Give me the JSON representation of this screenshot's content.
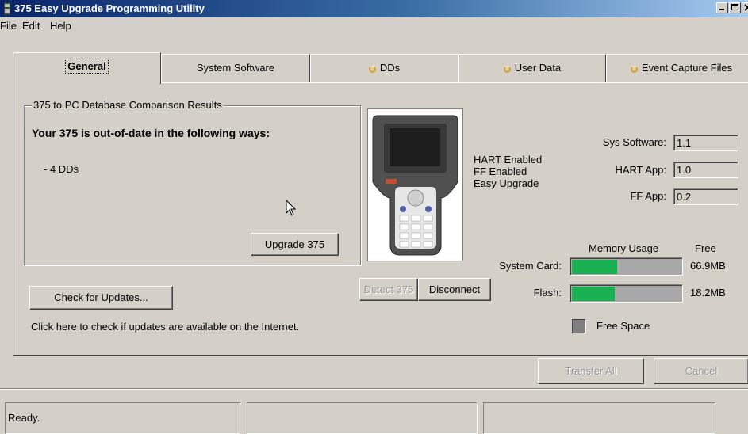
{
  "window": {
    "title": "375 Easy Upgrade Programming Utility"
  },
  "menu": [
    "File",
    "Edit",
    "Help"
  ],
  "tabs": [
    {
      "label": "General",
      "active": true,
      "icon": ""
    },
    {
      "label": "System Software",
      "active": false,
      "icon": ""
    },
    {
      "label": "DDs",
      "active": false,
      "icon": "status-circle-icon"
    },
    {
      "label": "User Data",
      "active": false,
      "icon": "status-circle-icon"
    },
    {
      "label": "Event Capture Files",
      "active": false,
      "icon": "status-circle-icon"
    }
  ],
  "comparison": {
    "group_title": "375 to PC Database Comparison Results",
    "heading": "Your 375 is out-of-date in the following ways:",
    "items": [
      "- 4 DDs"
    ],
    "upgrade_button": "Upgrade 375"
  },
  "updates": {
    "check_button": "Check for Updates...",
    "hint": "Click here to check if updates are available on the Internet."
  },
  "device": {
    "capabilities": [
      "HART Enabled",
      "FF Enabled",
      "Easy Upgrade"
    ],
    "detect_button": "Detect 375",
    "disconnect_button": "Disconnect",
    "versions": [
      {
        "label": "Sys Software:",
        "value": "1.1"
      },
      {
        "label": "HART App:",
        "value": "1.0"
      },
      {
        "label": "FF App:",
        "value": "0.2"
      }
    ]
  },
  "memory": {
    "header": "Memory Usage",
    "free_header": "Free",
    "rows": [
      {
        "label": "System Card:",
        "used_fraction": 0.41,
        "free": "66.9MB"
      },
      {
        "label": "Flash:",
        "used_fraction": 0.39,
        "free": "18.2MB"
      }
    ],
    "legend": "Free Space",
    "used_color": "#18b050",
    "free_color": "#a8a8a8"
  },
  "actions": {
    "transfer_all": "Transfer All",
    "cancel": "Cancel"
  },
  "status": {
    "text": "Ready.",
    "cell2": "",
    "cell3": ""
  }
}
